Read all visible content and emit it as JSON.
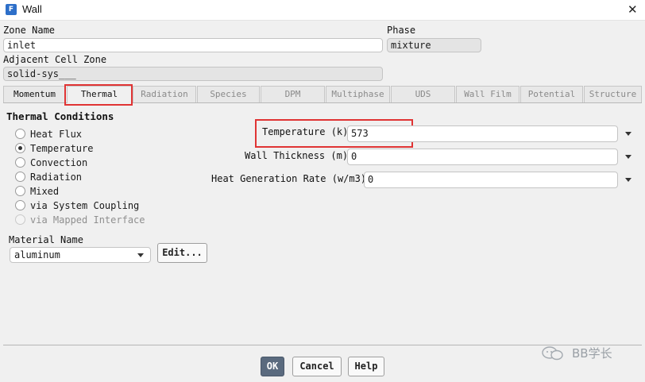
{
  "window": {
    "title": "Wall",
    "app_icon_letter": "F"
  },
  "zone_name": {
    "label": "Zone Name",
    "value": "inlet"
  },
  "phase": {
    "label": "Phase",
    "value": "mixture"
  },
  "adjacent_cell_zone": {
    "label": "Adjacent Cell Zone",
    "value": "solid-sys___"
  },
  "tabs": [
    {
      "label": "Momentum",
      "state": "enabled"
    },
    {
      "label": "Thermal",
      "state": "active"
    },
    {
      "label": "Radiation",
      "state": "disabled"
    },
    {
      "label": "Species",
      "state": "disabled"
    },
    {
      "label": "DPM",
      "state": "disabled"
    },
    {
      "label": "Multiphase",
      "state": "disabled"
    },
    {
      "label": "UDS",
      "state": "disabled"
    },
    {
      "label": "Wall Film",
      "state": "disabled"
    },
    {
      "label": "Potential",
      "state": "disabled"
    },
    {
      "label": "Structure",
      "state": "disabled"
    }
  ],
  "thermal_conditions": {
    "heading": "Thermal Conditions",
    "options": [
      {
        "label": "Heat Flux",
        "checked": false,
        "disabled": false
      },
      {
        "label": "Temperature",
        "checked": true,
        "disabled": false
      },
      {
        "label": "Convection",
        "checked": false,
        "disabled": false
      },
      {
        "label": "Radiation",
        "checked": false,
        "disabled": false
      },
      {
        "label": "Mixed",
        "checked": false,
        "disabled": false
      },
      {
        "label": "via System Coupling",
        "checked": false,
        "disabled": false
      },
      {
        "label": "via Mapped Interface",
        "checked": false,
        "disabled": true
      }
    ]
  },
  "temperature": {
    "label": "Temperature (k)",
    "value": "573"
  },
  "wall_thickness": {
    "label": "Wall Thickness (m)",
    "value": "0"
  },
  "heat_generation_rate": {
    "label": "Heat Generation Rate (w/m3)",
    "value": "0"
  },
  "material": {
    "label": "Material Name",
    "value": "aluminum",
    "edit_label": "Edit..."
  },
  "buttons": {
    "ok": "OK",
    "cancel": "Cancel",
    "help": "Help"
  },
  "watermark": {
    "text": "BB学长"
  },
  "colors": {
    "highlight_box": "#e03434",
    "ok_button": "#5a6a7e",
    "app_icon": "#2d6fc9"
  }
}
